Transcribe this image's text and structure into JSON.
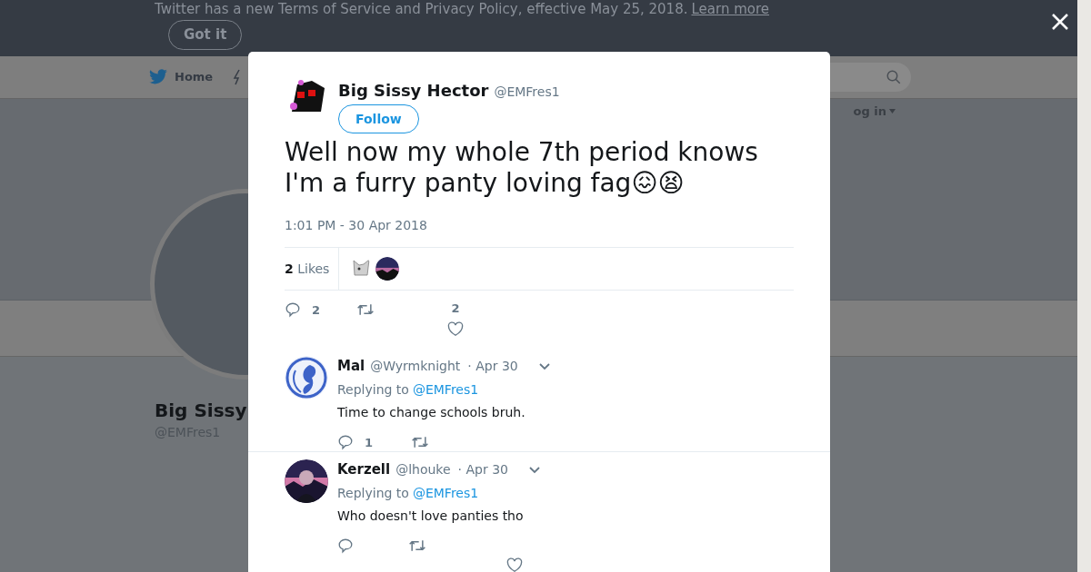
{
  "banner": {
    "text": "Twitter has a new Terms of Service and Privacy Policy, effective May 25, 2018.",
    "link": "Learn more",
    "button": "Got it"
  },
  "nav": {
    "home": "Home",
    "login": "og in"
  },
  "profile": {
    "name": "Big Sissy",
    "handle": "@EMFres1"
  },
  "tweet": {
    "name": "Big Sissy Hector",
    "handle": "@EMFres1",
    "follow": "Follow",
    "text": "Well now my whole 7th period knows I'm a furry panty loving fag😖😫",
    "time": "1:01 PM - 30 Apr 2018",
    "likes_count": "2",
    "likes_label": "Likes",
    "reply_count": "2",
    "like_count": "2"
  },
  "replies": [
    {
      "name": "Mal",
      "handle": "@Wyrmknight",
      "date": "· Apr 30",
      "replying": "Replying to",
      "mention": "@EMFres1",
      "text": "Time to change schools bruh.",
      "reply_count": "1"
    },
    {
      "name": "Kerzell",
      "handle": "@lhouke",
      "date": "· Apr 30",
      "replying": "Replying to",
      "mention": "@EMFres1",
      "text": "Who doesn't love panties tho"
    }
  ]
}
